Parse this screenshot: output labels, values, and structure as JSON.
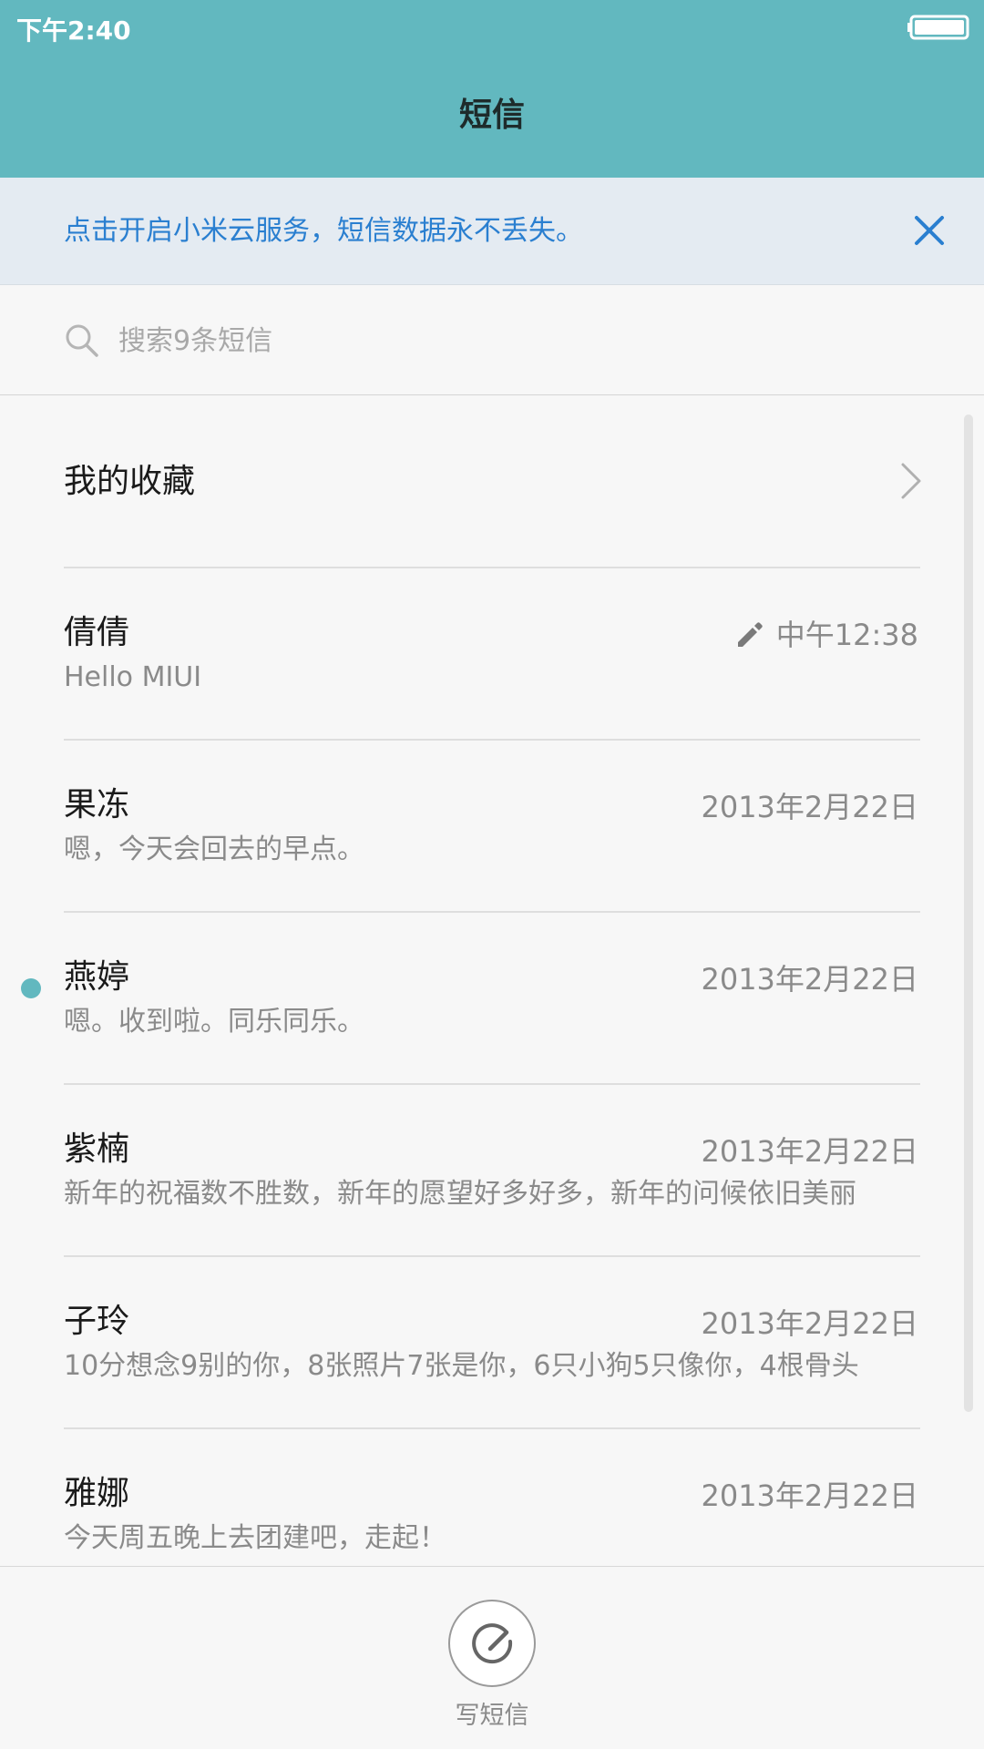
{
  "status_bar": {
    "time": "下午2:40"
  },
  "header": {
    "title": "短信"
  },
  "banner": {
    "text": "点击开启小米云服务，短信数据永不丢失。"
  },
  "search": {
    "placeholder": "搜索9条短信"
  },
  "favorites": {
    "label": "我的收藏"
  },
  "conversations": [
    {
      "name": "倩倩",
      "preview": "Hello MIUI",
      "time": "中午12:38",
      "draft": true,
      "unread": false
    },
    {
      "name": "果冻",
      "preview": "嗯，今天会回去的早点。",
      "time": "2013年2月22日",
      "draft": false,
      "unread": false
    },
    {
      "name": "燕婷",
      "preview": "嗯。收到啦。同乐同乐。",
      "time": "2013年2月22日",
      "draft": false,
      "unread": true
    },
    {
      "name": "紫楠",
      "preview": "新年的祝福数不胜数，新年的愿望好多好多，新年的问候依旧美丽",
      "time": "2013年2月22日",
      "draft": false,
      "unread": false
    },
    {
      "name": "子玲",
      "preview": "10分想念9别的你，8张照片7张是你，6只小狗5只像你，4根骨头",
      "time": "2013年2月22日",
      "draft": false,
      "unread": false
    },
    {
      "name": "雅娜",
      "preview": "今天周五晚上去团建吧，走起！",
      "time": "2013年2月22日",
      "draft": false,
      "unread": false
    }
  ],
  "compose": {
    "label": "写短信"
  },
  "colors": {
    "header_bg": "#62b8bf",
    "banner_bg": "#e4ebf2",
    "banner_text": "#2a7fd0",
    "unread_dot": "#62b8bf"
  }
}
